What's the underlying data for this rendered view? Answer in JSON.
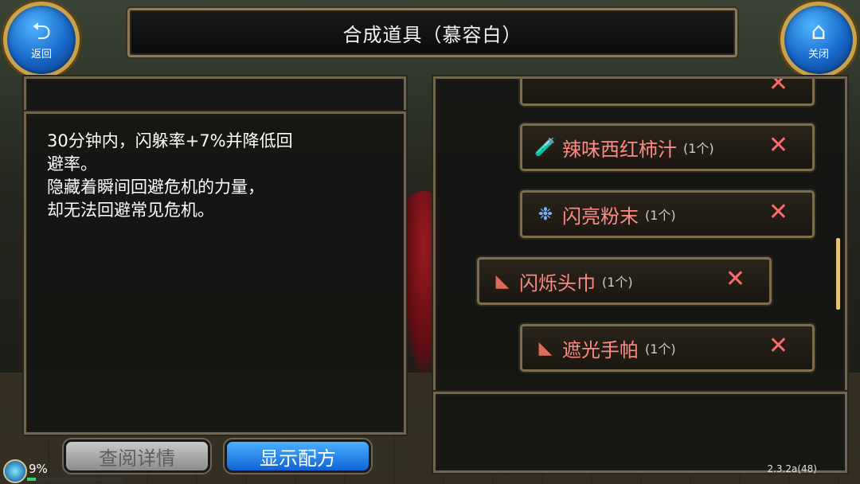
{
  "header": {
    "title": "合成道具（慕容白）",
    "back_label": "返回",
    "close_label": "关闭"
  },
  "description": {
    "lines": [
      "30分钟内，闪躲率+7%并降低回",
      "避率。",
      "隐藏着瞬间回避危机的力量，",
      "却无法回避常见危机。"
    ]
  },
  "items": [
    {
      "name": "辣味西红柿汁",
      "count": "(1个)",
      "icon": "red-bottle-icon"
    },
    {
      "name": "闪亮粉末",
      "count": "(1个)",
      "icon": "blue-powder-icon"
    },
    {
      "name": "闪烁头巾",
      "count": "(1个)",
      "icon": "red-scarf-icon"
    },
    {
      "name": "遮光手帕",
      "count": "(1个)",
      "icon": "red-scarf-icon"
    }
  ],
  "buttons": {
    "details_label": "查阅详情",
    "recipe_label": "显示配方"
  },
  "status": {
    "percent": "9%",
    "progress": 0.09,
    "version": "2.3.2a(48)"
  },
  "colors": {
    "item_name": "#ff8a82",
    "remove_x": "#ff6a6a",
    "accent_blue": "#1767c8",
    "frame_gold": "#c9a24a"
  }
}
